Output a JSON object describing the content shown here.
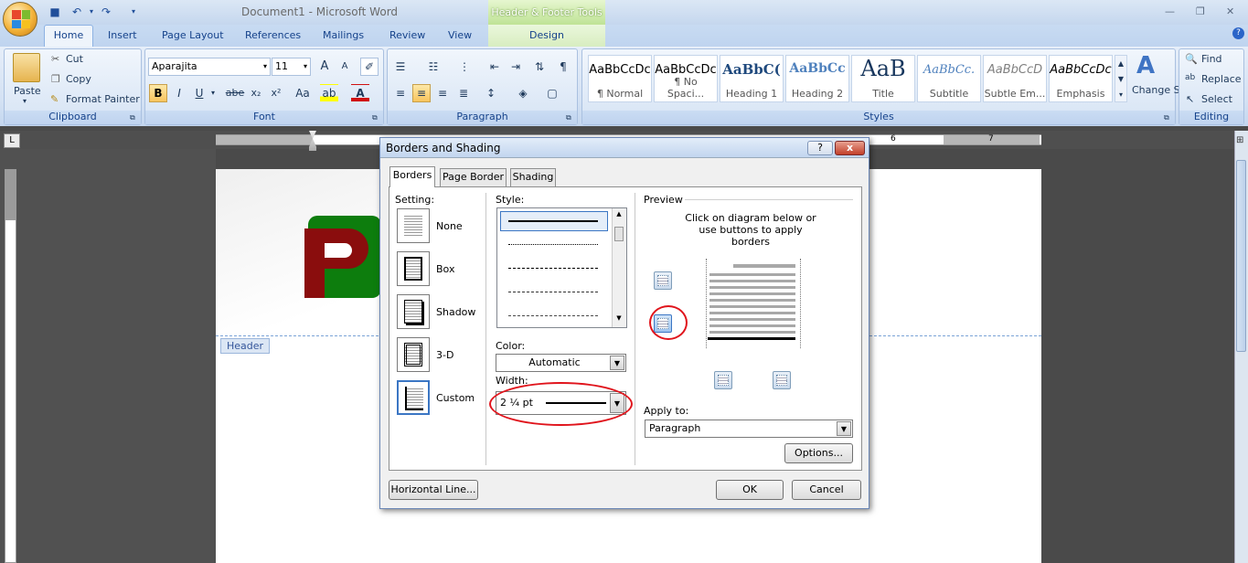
{
  "titlebar": {
    "doc_title": "Document1 - Microsoft Word",
    "contextual_tools": "Header & Footer Tools"
  },
  "tabs": [
    "Home",
    "Insert",
    "Page Layout",
    "References",
    "Mailings",
    "Review",
    "View"
  ],
  "contextual_tab": "Design",
  "clipboard": {
    "paste": "Paste",
    "cut": "Cut",
    "copy": "Copy",
    "format_painter": "Format Painter",
    "group": "Clipboard"
  },
  "font": {
    "name": "Aparajita",
    "size": "11",
    "group": "Font",
    "bold": "B",
    "italic": "I",
    "underline": "U",
    "strike": "abe",
    "sub": "x₂",
    "sup": "x²",
    "aa": "Aa",
    "grow": "A",
    "shrink": "A"
  },
  "paragraph": {
    "group": "Paragraph"
  },
  "styles": {
    "group": "Styles",
    "items": [
      {
        "preview": "AaBbCcDc",
        "name": "¶ Normal"
      },
      {
        "preview": "AaBbCcDc",
        "name": "¶ No Spaci..."
      },
      {
        "preview": "AaBbC(",
        "name": "Heading 1"
      },
      {
        "preview": "AaBbCc",
        "name": "Heading 2"
      },
      {
        "preview": "AaB",
        "name": "Title"
      },
      {
        "preview": "AaBbCc.",
        "name": "Subtitle"
      },
      {
        "preview": "AaBbCcD",
        "name": "Subtle Em..."
      },
      {
        "preview": "AaBbCcDc",
        "name": "Emphasis"
      }
    ],
    "change_styles": "Change Styles"
  },
  "editing": {
    "group": "Editing",
    "find": "Find",
    "replace": "Replace",
    "select": "Select"
  },
  "ruler": {
    "corner": "L",
    "marks": [
      "6",
      "7"
    ]
  },
  "header_tag": "Header",
  "dialog": {
    "title": "Borders and Shading",
    "help": "?",
    "close": "x",
    "tabs": [
      "Borders",
      "Page Border",
      "Shading"
    ],
    "setting_label": "Setting:",
    "settings": [
      "None",
      "Box",
      "Shadow",
      "3-D",
      "Custom"
    ],
    "style_label": "Style:",
    "color_label": "Color:",
    "color_value": "Automatic",
    "width_label": "Width:",
    "width_value": "2 ¼ pt",
    "preview_label": "Preview",
    "preview_hint": "Click on diagram below or use buttons to apply borders",
    "apply_label": "Apply to:",
    "apply_value": "Paragraph",
    "options": "Options...",
    "horizontal_line": "Horizontal Line...",
    "ok": "OK",
    "cancel": "Cancel"
  }
}
